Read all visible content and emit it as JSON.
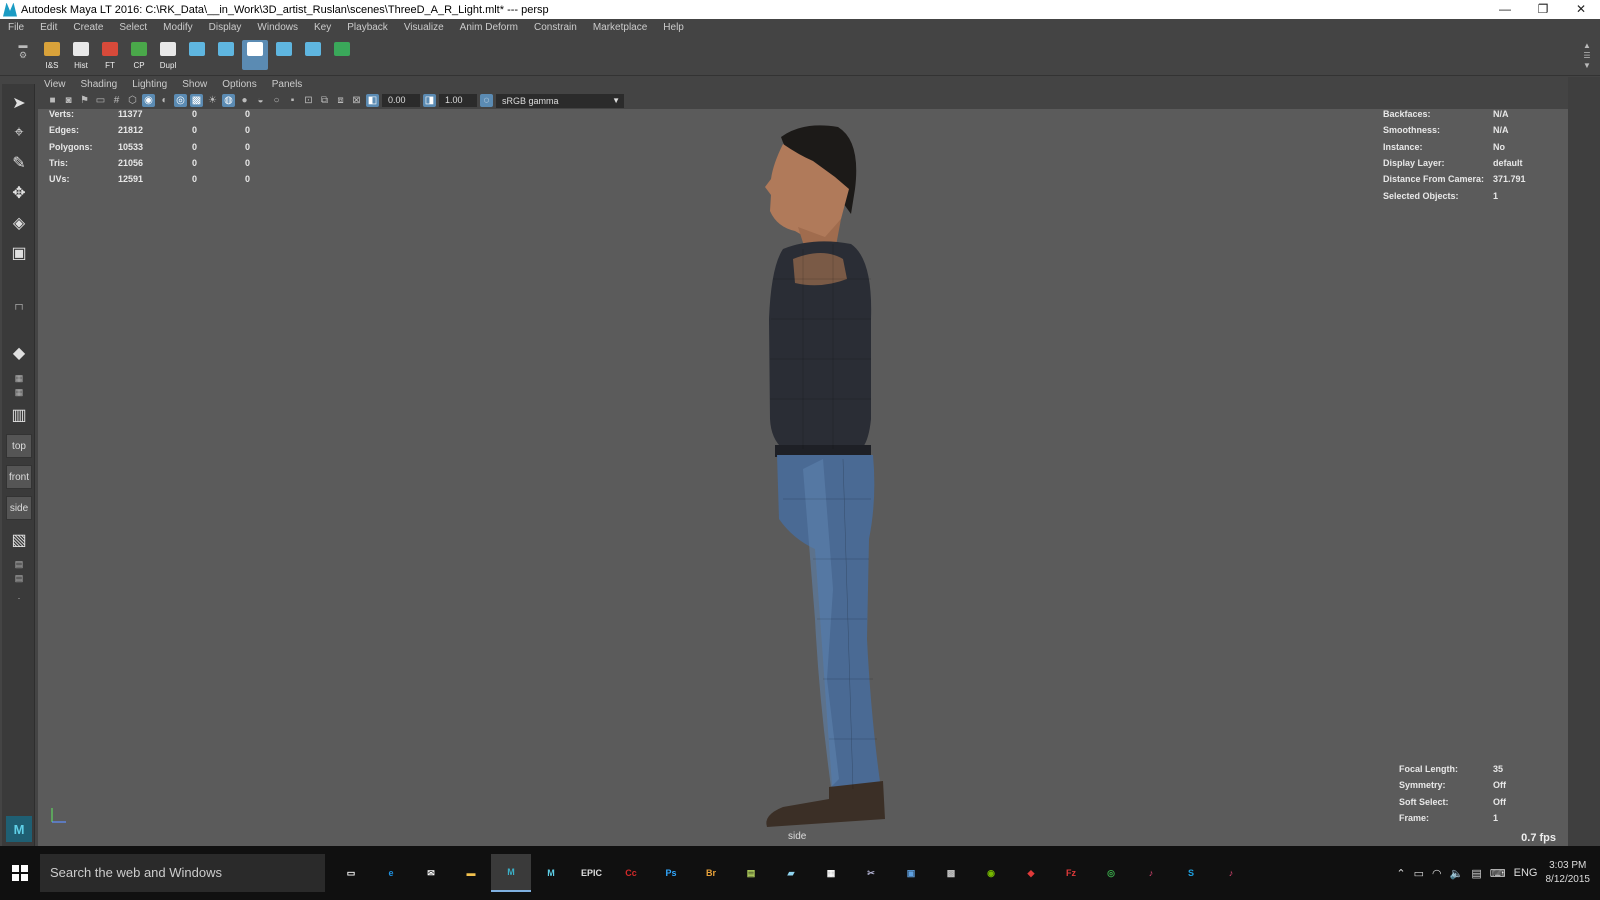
{
  "window": {
    "title": "Autodesk Maya LT 2016: C:\\RK_Data\\__in_Work\\3D_artist_Ruslan\\scenes\\ThreeD_A_R_Light.mlt*   ---   persp",
    "minimize": "—",
    "maximize": "❐",
    "close": "✕"
  },
  "menu": [
    "File",
    "Edit",
    "Create",
    "Select",
    "Modify",
    "Display",
    "Windows",
    "Key",
    "Playback",
    "Visualize",
    "Anim Deform",
    "Constrain",
    "Marketplace",
    "Help"
  ],
  "shelf": {
    "buttons": [
      {
        "label": "I&S",
        "icon": "import-folder-icon",
        "color": "#d9a23a"
      },
      {
        "label": "Hist",
        "icon": "history-icon",
        "color": "#e8e8e8"
      },
      {
        "label": "FT",
        "icon": "freeze-transform-icon",
        "color": "#d84a3a"
      },
      {
        "label": "CP",
        "icon": "center-pivot-icon",
        "color": "#4aa84a"
      },
      {
        "label": "Dupl",
        "icon": "duplicate-icon",
        "color": "#e8e8e8"
      },
      {
        "label": "",
        "icon": "camera-pan-icon",
        "color": "#5fb6e0"
      },
      {
        "label": "",
        "icon": "camera-track-icon",
        "color": "#5fb6e0"
      },
      {
        "label": "",
        "icon": "camera-dolly-icon",
        "color": "#ffffff"
      },
      {
        "label": "",
        "icon": "camera-zoom-icon",
        "color": "#5fb6e0"
      },
      {
        "label": "",
        "icon": "camera-settings-icon",
        "color": "#5fb6e0"
      },
      {
        "label": "",
        "icon": "color-wheel-icon",
        "color": "#3aa85a"
      }
    ]
  },
  "viewport_menu": [
    "View",
    "Shading",
    "Lighting",
    "Show",
    "Options",
    "Panels"
  ],
  "viewport_toolbar": {
    "exposure": "0.00",
    "gamma": "1.00",
    "color_space": "sRGB gamma"
  },
  "toolbox": {
    "top_label": "top",
    "front_label": "front",
    "side_label": "side"
  },
  "hud_left": {
    "rows": [
      {
        "label": "Verts:",
        "a": "11377",
        "b": "0",
        "c": "0"
      },
      {
        "label": "Edges:",
        "a": "21812",
        "b": "0",
        "c": "0"
      },
      {
        "label": "Polygons:",
        "a": "10533",
        "b": "0",
        "c": "0"
      },
      {
        "label": "Tris:",
        "a": "21056",
        "b": "0",
        "c": "0"
      },
      {
        "label": "UVs:",
        "a": "12591",
        "b": "0",
        "c": "0"
      }
    ]
  },
  "hud_right": {
    "rows": [
      {
        "label": "Backfaces:",
        "value": "N/A"
      },
      {
        "label": "Smoothness:",
        "value": "N/A"
      },
      {
        "label": "Instance:",
        "value": "No"
      },
      {
        "label": "Display Layer:",
        "value": "default"
      },
      {
        "label": "Distance From Camera:",
        "value": "371.791"
      },
      {
        "label": "Selected Objects:",
        "value": "1"
      }
    ]
  },
  "hud_bottom_right": {
    "rows": [
      {
        "label": "Focal Length:",
        "value": "35"
      },
      {
        "label": "Symmetry:",
        "value": "Off"
      },
      {
        "label": "Soft Select:",
        "value": "Off"
      },
      {
        "label": "Frame:",
        "value": "1"
      }
    ]
  },
  "camera_label": "side",
  "fps": "0.7 fps",
  "taskbar": {
    "search_placeholder": "Search the web and Windows",
    "language": "ENG",
    "time": "3:03 PM",
    "date": "8/12/2015",
    "apps": [
      {
        "name": "task-view-icon",
        "text": "▭",
        "color": "#ffffff"
      },
      {
        "name": "edge-icon",
        "text": "e",
        "color": "#1e90e0"
      },
      {
        "name": "mail-icon",
        "text": "✉",
        "color": "#ffffff"
      },
      {
        "name": "file-explorer-icon",
        "text": "▬",
        "color": "#f2c14e"
      },
      {
        "name": "maya-icon",
        "text": "M",
        "color": "#3ab0c8"
      },
      {
        "name": "maya-lt-icon",
        "text": "M",
        "color": "#5fd0e8"
      },
      {
        "name": "epic-launcher-icon",
        "text": "EPIC",
        "color": "#dddddd"
      },
      {
        "name": "creative-cloud-icon",
        "text": "Cc",
        "color": "#d42a2a"
      },
      {
        "name": "photoshop-icon",
        "text": "Ps",
        "color": "#31a8ff"
      },
      {
        "name": "bridge-icon",
        "text": "Br",
        "color": "#e8a23a"
      },
      {
        "name": "notepad-icon",
        "text": "▤",
        "color": "#b8d860"
      },
      {
        "name": "stickies-icon",
        "text": "▰",
        "color": "#8fd4f0"
      },
      {
        "name": "calculator-icon",
        "text": "▦",
        "color": "#ffffff"
      },
      {
        "name": "snipping-icon",
        "text": "✂",
        "color": "#b0b0d0"
      },
      {
        "name": "remote-desktop-icon",
        "text": "▣",
        "color": "#5fa0e0"
      },
      {
        "name": "network-icon",
        "text": "▩",
        "color": "#c0c0c0"
      },
      {
        "name": "nvidia-icon",
        "text": "◉",
        "color": "#76b900"
      },
      {
        "name": "substance-icon",
        "text": "◆",
        "color": "#e03a3a"
      },
      {
        "name": "filezilla-icon",
        "text": "Fz",
        "color": "#e03a3a"
      },
      {
        "name": "xbox-icon",
        "text": "◎",
        "color": "#3aa84a"
      },
      {
        "name": "itunes-icon",
        "text": "♪",
        "color": "#e84a7a"
      },
      {
        "name": "skype-icon",
        "text": "S",
        "color": "#1ea0e0"
      },
      {
        "name": "itunes-alt-icon",
        "text": "♪",
        "color": "#e84a7a"
      }
    ]
  }
}
